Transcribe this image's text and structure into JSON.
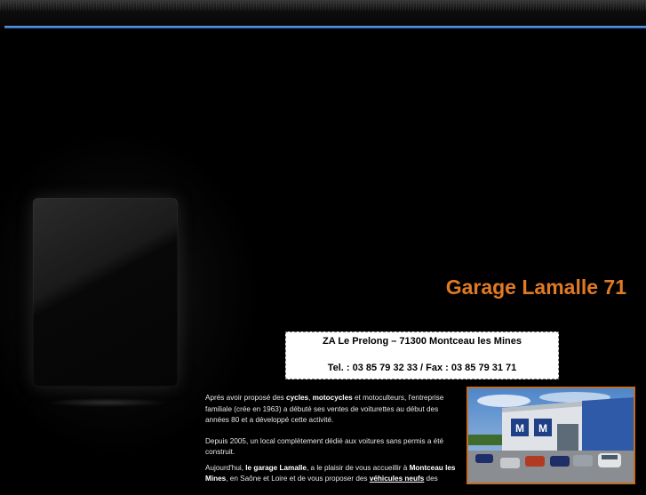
{
  "header": {
    "site_title": "Garage Lamalle 71"
  },
  "contact": {
    "address": "ZA Le Prelong – 71300 Montceau les Mines",
    "phone_fax": "Tel. : 03 85 79 32 33 / Fax : 03 85 79 31 71"
  },
  "intro": {
    "p1": {
      "t1": "Après avoir proposé des ",
      "b1": "cycles",
      "t2": ", ",
      "b2": "motocycles",
      "t3": " et motoculteurs, l'entreprise familiale (crée en 1963) a débuté ses ventes de voiturettes au début des années 80 et a développé cette activité."
    },
    "p2": "Depuis 2005, un local complètement dédié aux voitures sans permis a été construit.",
    "p3": {
      "t1": "Aujourd'hui, ",
      "b1": "le garage Lamalle",
      "t2": ", a le plaisir de vous accueillir à ",
      "b2": "Montceau les Mines",
      "t3": ", en Saône et Loire et de vous proposer des ",
      "link": "véhicules neufs",
      "t4": " des"
    }
  },
  "colors": {
    "accent": "#e07a24",
    "rule": "#4a86d8",
    "background": "#000000"
  }
}
